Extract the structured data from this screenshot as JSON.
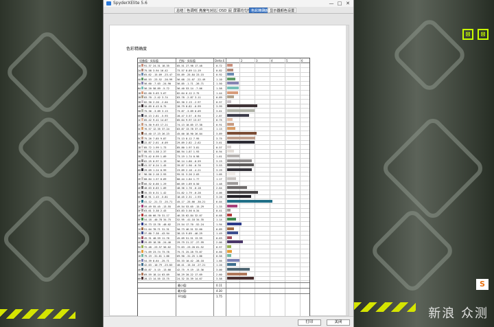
{
  "window": {
    "title": "SpyderXElite 5.6",
    "controls": [
      "—",
      "□",
      "✕"
    ]
  },
  "tabs": [
    "总结",
    "色调响应",
    "亮度与对比度",
    "OSD 设备",
    "屏幕均匀性",
    "色彩精确度",
    "显示器颜色设置"
  ],
  "active_tab": 5,
  "document": {
    "title": "色彩精确度",
    "headers": {
      "col_a": "设备值 · 实际值",
      "col_b": "目标 · 实际值",
      "col_delta": "Delta E",
      "scale": [
        "2",
        "3",
        "4",
        "5",
        "6"
      ]
    },
    "rows": [
      {
        "id": "1A",
        "a": "91.37  24.31  18.35",
        "b": "85.51  27.98  17.48",
        "d": "0.72",
        "c": "#c98f7c"
      },
      {
        "id": "2A",
        "a": "75.58  3.94  16.42",
        "b": "73.57  8.89  11.19",
        "d": "0.82",
        "c": "#b38a79"
      },
      {
        "id": "3A",
        "a": "65.62 -15.09  -23.47",
        "b": "55.89 -25.84  23.15",
        "d": "0.92",
        "c": "#6b8cb2"
      },
      {
        "id": "4A",
        "a": "66.53 -23.52  -20.99",
        "b": "56.68 -21.07 -22.49",
        "d": "1.10",
        "c": "#5f9c66"
      },
      {
        "id": "5A",
        "a": "56.60  -7.03  -24.90",
        "b": "56.85  -1.71 -26.71",
        "d": "1.50",
        "c": "#8785b3"
      },
      {
        "id": "6A",
        "a": "56.20  58.89  -5.72",
        "b": "56.40  53.14  -7.06",
        "d": "1.58",
        "c": "#78c0b8"
      },
      {
        "id": "1B",
        "a": "82.60   5.03   3.67",
        "b": "82.64   6.12   2.75",
        "d": "1.44",
        "c": "#d89c7a"
      },
      {
        "id": "2B",
        "a": "83.70  -2.42   3.74",
        "b": "83.78  -2.87   3.11",
        "d": "0.89",
        "c": "#b3a38c"
      },
      {
        "id": "3B",
        "a": "82.30   2.20  -2.04",
        "b": "82.30   2.13  -2.97",
        "d": "0.57",
        "c": "#c8c0c6"
      },
      {
        "id": "4B",
        "a": "30.89   6.43   0.75",
        "b": "28.79   8.82  -0.99",
        "d": "3.99",
        "c": "#3e3236"
      },
      {
        "id": "5B",
        "a": "75.36  -3.89   3.13",
        "b": "73.87  -3.89   0.09",
        "d": "3.61",
        "c": "#b0b3a8"
      },
      {
        "id": "6B",
        "a": "38.13   2.81  -5.93",
        "b": "28.47   3.57  -8.94",
        "d": "2.87",
        "c": "#3a3a48"
      },
      {
        "id": "1C",
        "a": "85.42   9.41  14.07",
        "b": "85.64   9.97  13.57",
        "d": "0.75",
        "c": "#e1bca6"
      },
      {
        "id": "2C",
        "a": "74.30   9.63  17.21",
        "b": "74.13  10.85  17.38",
        "d": "0.91",
        "c": "#c79a7f"
      },
      {
        "id": "3C",
        "a": "76.57  12.35  37.24",
        "b": "83.87  13.78  37.43",
        "d": "1.13",
        "c": "#d99d66"
      },
      {
        "id": "4C",
        "a": "44.40  17.23  26.23",
        "b": "45.00  18.90  26.04",
        "d": "3.89",
        "c": "#7a4c34"
      },
      {
        "id": "5C",
        "a": "75.26   7.85   9.87",
        "b": "73.13   8.12   7.95",
        "d": "3.75",
        "c": "#c0a08e"
      },
      {
        "id": "6C",
        "a": "22.87   2.61  -6.09",
        "b": "29.89   2.82  -2.62",
        "d": "3.61",
        "c": "#2b2a33"
      },
      {
        "id": "1D",
        "a": "85.72   1.99   1.73",
        "b": "85.80   1.97   3.81",
        "d": "0.57",
        "c": "#d8d2d0"
      },
      {
        "id": "2D",
        "a": "88.93   1.58   2.37",
        "b": "88.94   1.87   1.93",
        "d": "0.94",
        "c": "#e2dcd6"
      },
      {
        "id": "3D",
        "a": "73.42   0.99   1.09",
        "b": "73.19   1.74   0.98",
        "d": "1.61",
        "c": "#b8b4b2"
      },
      {
        "id": "4D",
        "a": "62.25   0.97   1.19",
        "b": "56.14   1.80  -0.59",
        "d": "3.23",
        "c": "#8f8c8c"
      },
      {
        "id": "5D",
        "a": "41.57   0.24   1.45",
        "b": "39.87   1.90  -0.76",
        "d": "3.53",
        "c": "#5c5a5a"
      },
      {
        "id": "6D",
        "a": "29.09   1.24   0.99",
        "b": "23.89   2.18  -4.21",
        "d": "3.29",
        "c": "#35333a"
      },
      {
        "id": "1E",
        "a": "96.56   2.18   2.93",
        "b": "95.51   3.26   2.03",
        "d": "1.05",
        "c": "#f1ece8"
      },
      {
        "id": "2E",
        "a": "80.84   1.57   0.69",
        "b": "80.44   1.84   1.77",
        "d": "1.17",
        "c": "#c8c4c2"
      },
      {
        "id": "3E",
        "a": "66.32   0.66   1.29",
        "b": "66.09   1.89   0.50",
        "d": "1.48",
        "c": "#9e9b9a"
      },
      {
        "id": "4E",
        "a": "48.63   0.83   1.09",
        "b": "48.36   1.76  -0.18",
        "d": "2.64",
        "c": "#6f6c6c"
      },
      {
        "id": "5E",
        "a": "35.33   0.31   1.42",
        "b": "31.82   1.79  -0.28",
        "d": "4.06",
        "c": "#4a4748"
      },
      {
        "id": "6E",
        "a": "18.91   1.43  -5.81",
        "b": "18.45   2.31  -1.93",
        "d": "3.20",
        "c": "#242228"
      },
      {
        "id": "1F",
        "a": "41.12 -21.72 -25.71",
        "b": "45.17 -25.66 -30.21",
        "d": "6.04",
        "c": "#1f6e86"
      },
      {
        "id": "2F",
        "a": "59.49  55.45 -13.55",
        "b": "49.54  53.65 -15.29",
        "d": "1.33",
        "c": "#a8407a"
      },
      {
        "id": "3F",
        "a": "63.61   3.38   2.43",
        "b": "63.83   3.56   0.34",
        "d": "0.41",
        "c": "#a39c99"
      },
      {
        "id": "4F",
        "a": "44.00  66.70  31.17",
        "b": "46.35  62.84  32.07",
        "d": "0.68",
        "c": "#b43a3a"
      },
      {
        "id": "5F",
        "a": "54.18 -40.78  34.75",
        "b": "52.95 -41.18  34.35",
        "d": "1.14",
        "c": "#3f8a4a"
      },
      {
        "id": "6F",
        "a": "26.73  13.78 -48.02",
        "b": "23.54  17.70 -52.24",
        "d": "1.94",
        "c": "#2b3a8a"
      },
      {
        "id": "1G",
        "a": "51.04  78.71  31.31",
        "b": "50.73  46.51  32.60",
        "d": "0.89",
        "c": "#a06b45"
      },
      {
        "id": "2G",
        "a": "37.80   7.38 -43.94",
        "b": "38.15   9.89 -46.29",
        "d": "1.49",
        "c": "#3d4f90"
      },
      {
        "id": "3G",
        "a": "45.31  48.59  11.76",
        "b": "45.09  51.51  13.59",
        "d": "0.63",
        "c": "#a04d5c"
      },
      {
        "id": "4G",
        "a": "29.89  18.38 -24.46",
        "b": "29.79  21.27 -27.99",
        "d": "2.06",
        "c": "#4a3568"
      },
      {
        "id": "5G",
        "a": "72.48 -23.57  56.62",
        "b": "72.63 -23.20  61.52",
        "d": "0.57",
        "c": "#96b04c"
      },
      {
        "id": "6G",
        "a": "71.69  23.74  73.78",
        "b": "75.71  25.28  73.87",
        "d": "0.60",
        "c": "#e59a34"
      },
      {
        "id": "1H",
        "a": "79.19 -31.61  1.86",
        "b": "69.90 -31.25   1.86",
        "d": "0.58",
        "c": "#6fb8a0"
      },
      {
        "id": "2H",
        "a": "54.39   8.64 -25.71",
        "b": "55.33  10.42 -28.18",
        "d": "1.66",
        "c": "#7a80b4"
      },
      {
        "id": "3H",
        "a": "42.63 -10.79 -23.83",
        "b": "40.41 -15.10 -27.21",
        "d": "1.20",
        "c": "#3e6e8e"
      },
      {
        "id": "4H",
        "a": "45.87  -5.15 -13.66",
        "b": "42.75  -9.19 -13.36",
        "d": "3.00",
        "c": "#4f6672"
      },
      {
        "id": "5H",
        "a": "69.59  18.14  63.09",
        "b": "58.29  20.22  17.69",
        "d": "2.60",
        "c": "#b0785a"
      },
      {
        "id": "6H",
        "a": "28.13  14.55  13.75",
        "b": "24.32  15.39  14.67",
        "d": "3.58",
        "c": "#4a3030"
      }
    ],
    "summary": [
      {
        "label": "最小值:",
        "value": "0.11"
      },
      {
        "label": "最大值:",
        "value": "4.30"
      },
      {
        "label": "平均值:",
        "value": "1.75"
      }
    ]
  },
  "buttons": {
    "print": "打印",
    "close": "关闭"
  },
  "watermark": "新浪 众测",
  "tray_icon": "S"
}
